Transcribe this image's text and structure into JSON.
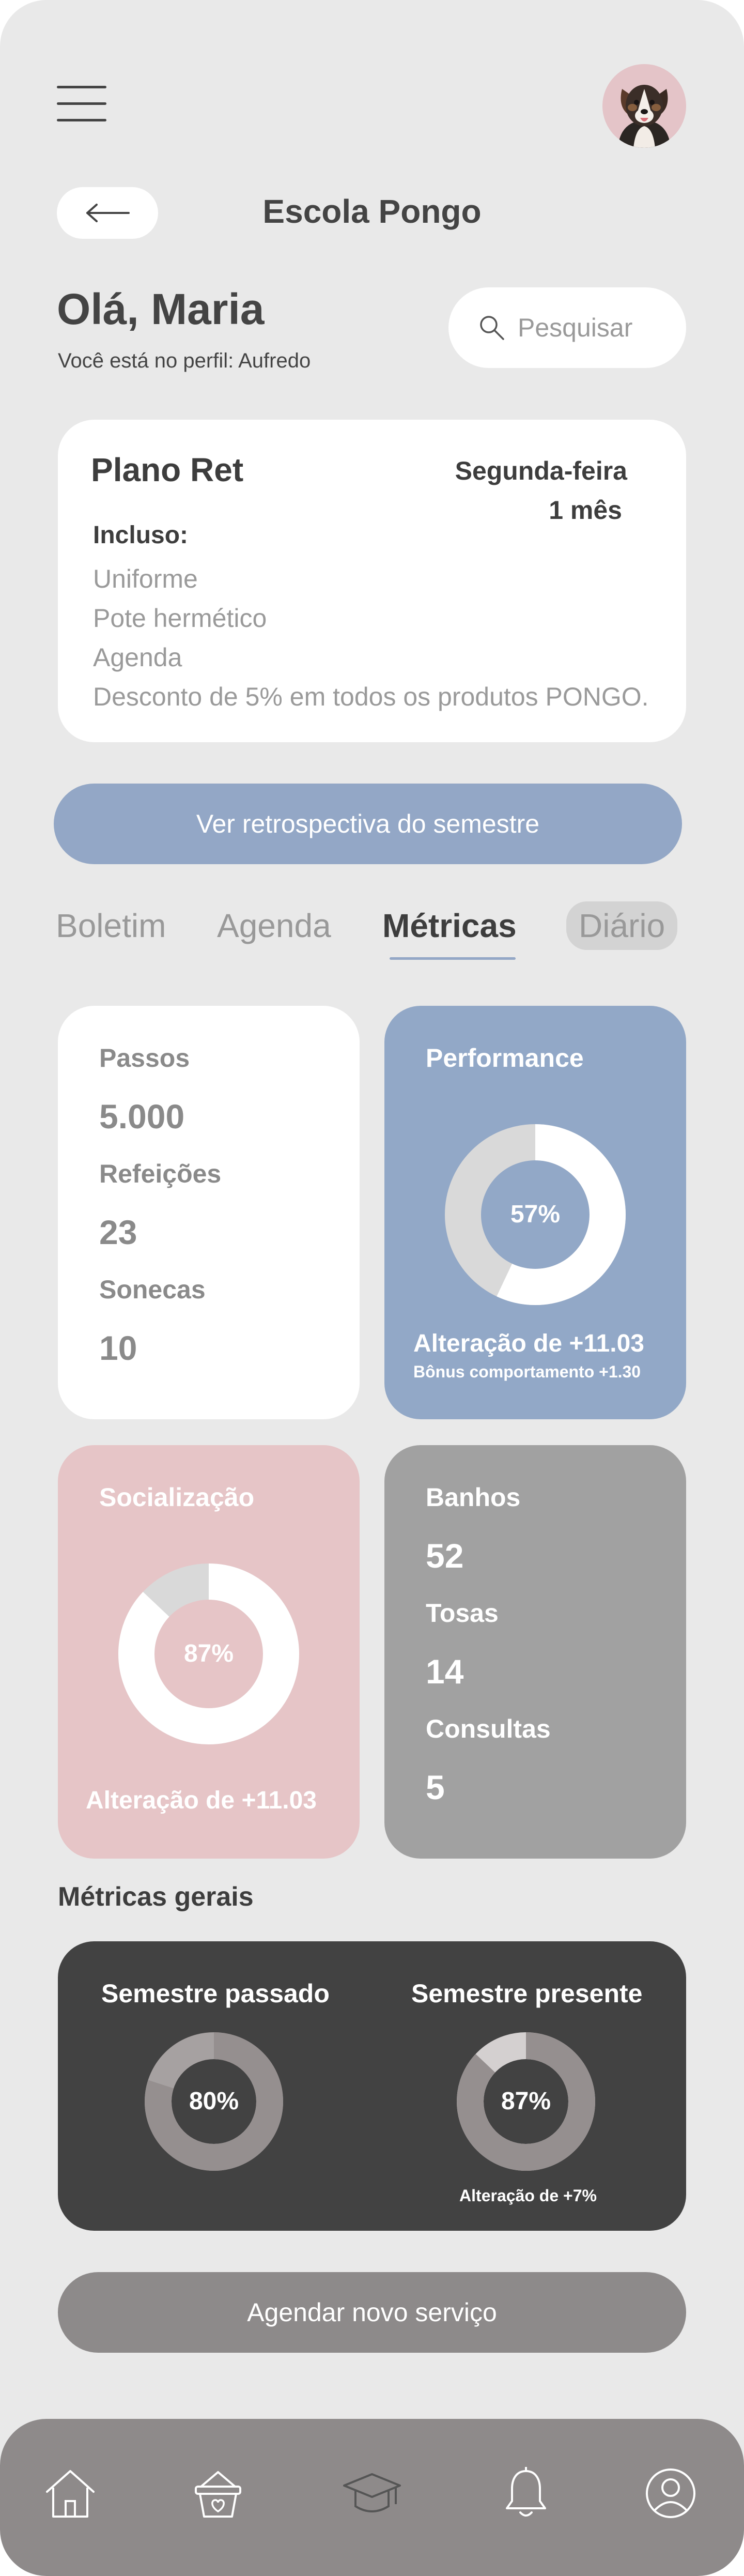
{
  "header": {
    "title": "Escola Pongo",
    "greeting": "Olá, Maria",
    "profile_text": "Você está no perfil: Aufredo",
    "search_placeholder": "Pesquisar"
  },
  "plan": {
    "name": "Plano Ret",
    "day": "Segunda-feira",
    "duration": "1 mês",
    "included_label": "Incluso:",
    "items": [
      "Uniforme",
      "Pote hermético",
      "Agenda",
      "Desconto de 5% em todos os produtos PONGO."
    ]
  },
  "retro_button": "Ver retrospectiva do semestre",
  "tabs": [
    {
      "label": "Boletim",
      "active": false
    },
    {
      "label": "Agenda",
      "active": false
    },
    {
      "label": "Métricas",
      "active": true
    },
    {
      "label": "Diário",
      "active": false
    }
  ],
  "stats_card": {
    "items": [
      {
        "label": "Passos",
        "value": "5.000"
      },
      {
        "label": "Refeições",
        "value": "23"
      },
      {
        "label": "Sonecas",
        "value": "10"
      }
    ]
  },
  "performance": {
    "title": "Performance",
    "percent": 57,
    "percent_label": "57%",
    "change": "Alteração de +11.03",
    "bonus": "Bônus comportamento +1.30"
  },
  "socialization": {
    "title": "Socialização",
    "percent": 87,
    "percent_label": "87%",
    "change": "Alteração de +11.03"
  },
  "services_card": {
    "items": [
      {
        "label": "Banhos",
        "value": "52"
      },
      {
        "label": "Tosas",
        "value": "14"
      },
      {
        "label": "Consultas",
        "value": "5"
      }
    ]
  },
  "general": {
    "title": "Métricas gerais",
    "past": {
      "label": "Semestre passado",
      "percent": 80,
      "percent_label": "80%"
    },
    "present": {
      "label": "Semestre presente",
      "percent": 87,
      "percent_label": "87%",
      "change": "Alteração de +7%"
    }
  },
  "schedule_button": "Agendar novo serviço",
  "nav": [
    "home-icon",
    "shop-basket-icon",
    "graduation-cap-icon",
    "bell-icon",
    "profile-icon"
  ],
  "colors": {
    "background": "#e9e9e9",
    "blue": "#92a8c7",
    "pink": "#e6c5c7",
    "gray": "#a1a1a1",
    "dark": "#424242",
    "nav": "#8e8a8a"
  }
}
